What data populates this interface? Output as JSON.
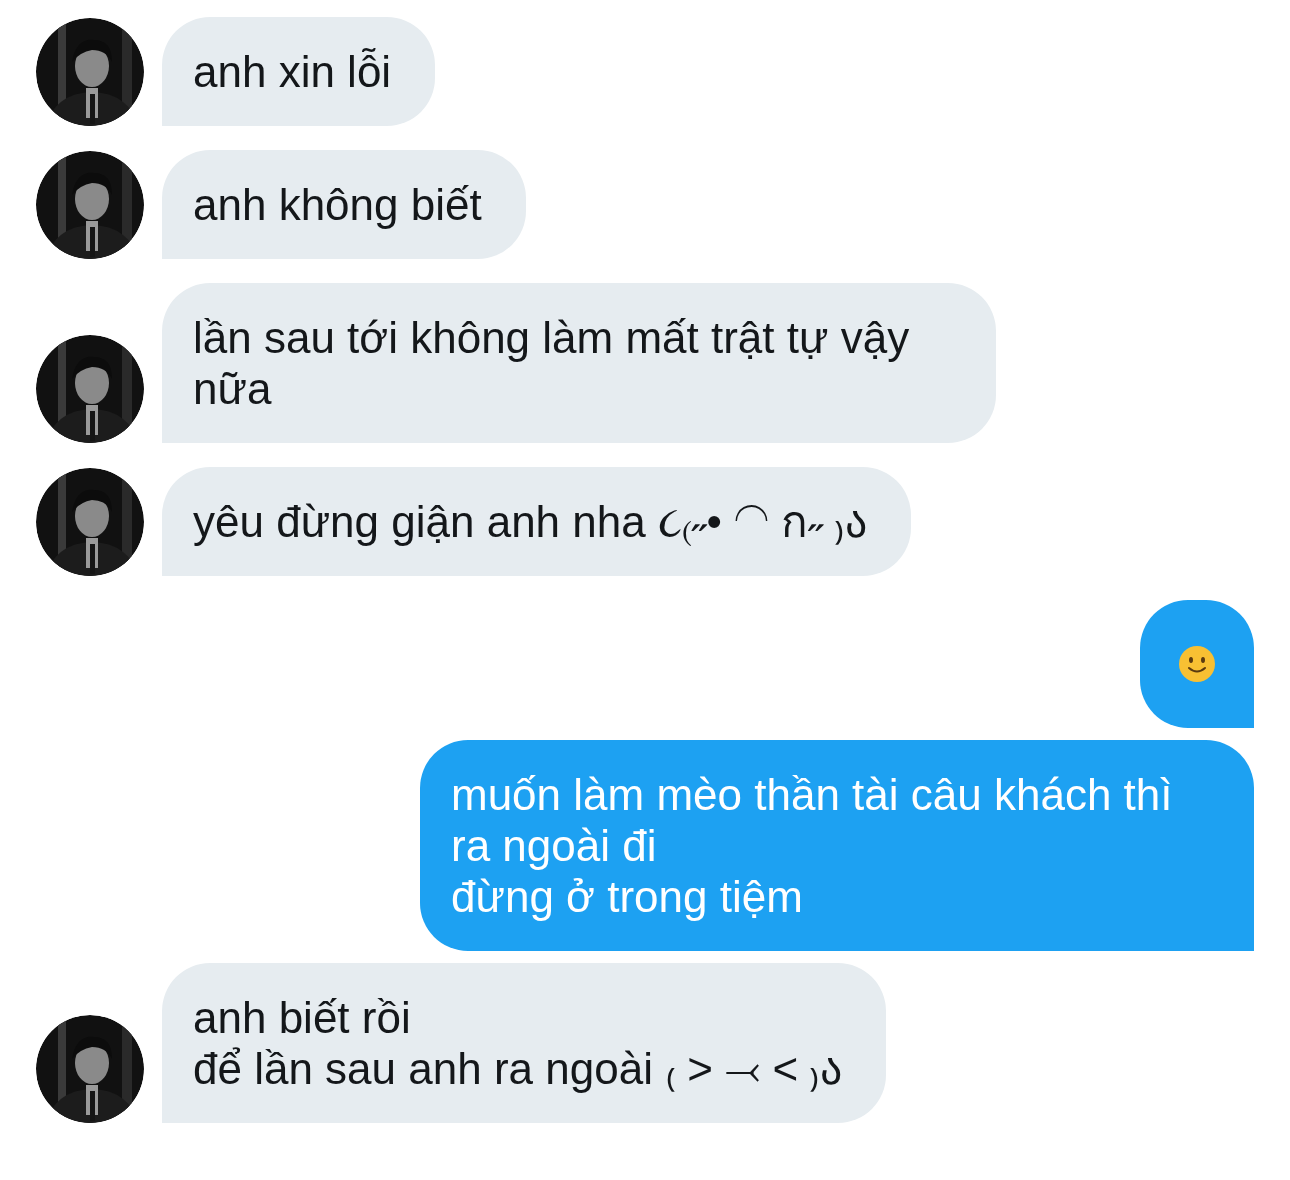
{
  "messages": [
    {
      "kind": "text",
      "sent": false,
      "lines": [
        "anh xin lỗi"
      ]
    },
    {
      "kind": "text",
      "sent": false,
      "lines": [
        "anh không biết"
      ]
    },
    {
      "kind": "text",
      "sent": false,
      "lines": [
        "lần sau tới không làm mất trật tự vậy nữa"
      ]
    },
    {
      "kind": "text",
      "sent": false,
      "lines": [
        "yêu đừng giận anh nha ૮₍˶• ◠ ก˶ ₎ა"
      ]
    },
    {
      "kind": "emoji",
      "sent": true
    },
    {
      "kind": "text",
      "sent": true,
      "lines": [
        "muốn làm mèo thần tài câu khách thì ra ngoài đi",
        "đừng ở trong tiệm"
      ]
    },
    {
      "kind": "text",
      "sent": false,
      "lines": [
        "anh biết rồi",
        "để lần sau anh ra ngoài ₍ ˃ ⤙ ˂ ₎ა"
      ]
    }
  ]
}
